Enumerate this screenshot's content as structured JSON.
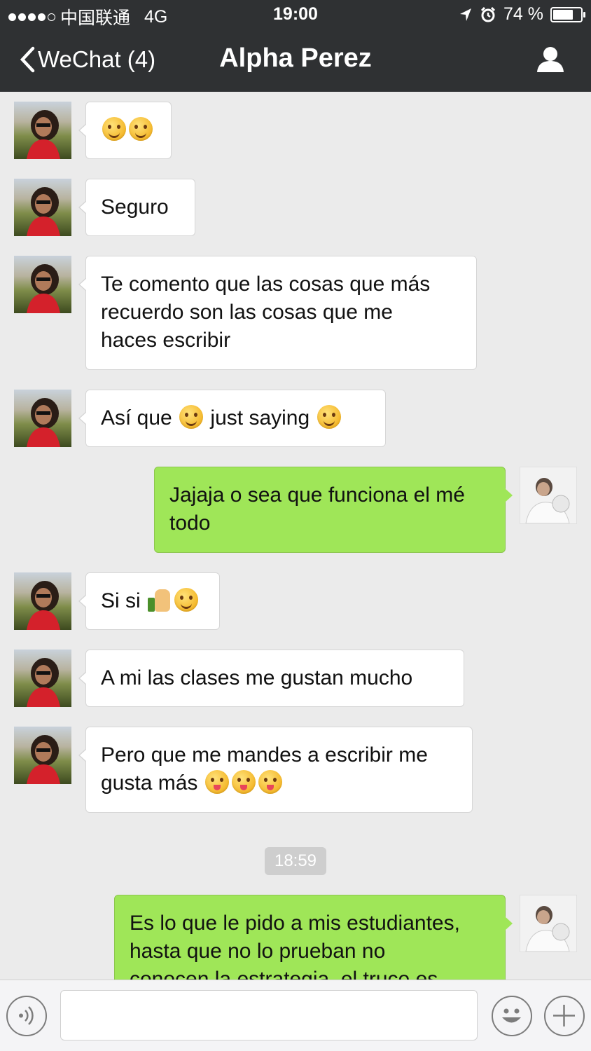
{
  "status_bar": {
    "carrier": "中国联通",
    "network": "4G",
    "time": "19:00",
    "battery": "74 %",
    "battery_level": 0.74
  },
  "nav": {
    "back_label": "WeChat (4)",
    "title": "Alpha Perez",
    "profile_icon": "person-icon"
  },
  "messages": [
    {
      "from": "contact",
      "text": ""
    },
    {
      "from": "contact",
      "text": "Seguro"
    },
    {
      "from": "contact",
      "lines": [
        "Te comento que las cosas que más",
        "recuerdo son las cosas que me",
        "haces escribir"
      ]
    },
    {
      "from": "contact",
      "text_a": "Así que",
      "text_b": "just saying"
    },
    {
      "from": "me",
      "lines": [
        "Jajaja o sea que funciona el mé",
        "todo"
      ]
    },
    {
      "from": "contact",
      "text": "Si si"
    },
    {
      "from": "contact",
      "text": "A mi las clases me gustan mucho"
    },
    {
      "from": "contact",
      "lines": [
        "Pero que me mandes a escribir me",
        "gusta más"
      ]
    },
    {
      "from": "me",
      "lines": [
        "Es lo que le pido a mis estudiantes,",
        "hasta que no lo prueban no",
        "conocen la estrategia, el truco es"
      ]
    }
  ],
  "timestamp": "18:59",
  "input_bar": {
    "voice_icon": "voice-icon",
    "emoji_icon": "emoji-icon",
    "plus_icon": "plus-icon",
    "text_value": ""
  },
  "colors": {
    "header_bg": "#2f3133",
    "chat_bg": "#ebebeb",
    "outgoing_bubble": "#9fe658",
    "incoming_bubble": "#ffffff"
  }
}
